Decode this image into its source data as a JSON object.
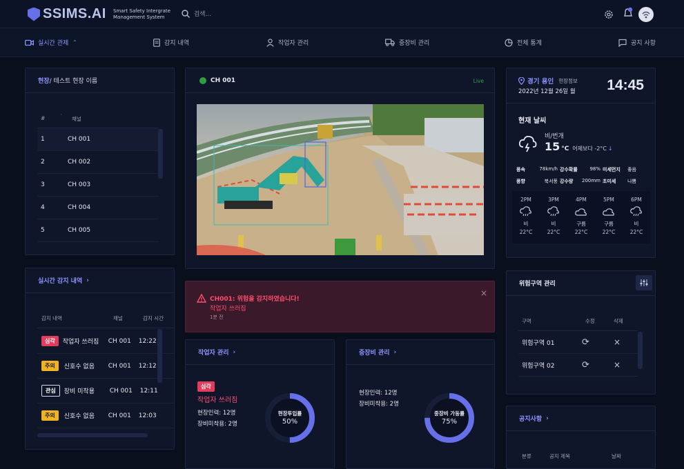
{
  "app": {
    "name": "SSIMS.AI",
    "subtitle_line1": "Smart Safety Intergrate",
    "subtitle_line2": "Management System",
    "search_placeholder": "검색..."
  },
  "nav": [
    {
      "label": "실시간 관제",
      "icon": "video-icon",
      "active": true
    },
    {
      "label": "감지 내역",
      "icon": "document-icon"
    },
    {
      "label": "작업자 관리",
      "icon": "user-icon"
    },
    {
      "label": "중장비 관리",
      "icon": "truck-icon"
    },
    {
      "label": "전체 통계",
      "icon": "pie-chart-icon"
    },
    {
      "label": "공지 사항",
      "icon": "message-icon"
    }
  ],
  "site": {
    "title_prefix": "현장",
    "title_rest": " / 테스트 현장 이름",
    "col_num": "#",
    "col_channel": "채널",
    "rows": [
      {
        "n": "1",
        "ch": "CH 001"
      },
      {
        "n": "2",
        "ch": "CH 002"
      },
      {
        "n": "3",
        "ch": "CH 003"
      },
      {
        "n": "4",
        "ch": "CH 004"
      },
      {
        "n": "5",
        "ch": "CH 005"
      }
    ]
  },
  "detect": {
    "title": "실시간 감지 내역",
    "col_type": "감지 내역",
    "col_channel": "채널",
    "col_time": "감지 시간",
    "rows": [
      {
        "badge": "심각",
        "style": "b-red",
        "text": "작업자 쓰러짐",
        "ch": "CH 001",
        "time": "12:22"
      },
      {
        "badge": "주의",
        "style": "b-yel",
        "text": "신호수 없음",
        "ch": "CH 001",
        "time": "12:12"
      },
      {
        "badge": "관심",
        "style": "b-out",
        "text": "장비 미착용",
        "ch": "CH 001",
        "time": "12:11"
      },
      {
        "badge": "주의",
        "style": "b-yel",
        "text": "신호수 없음",
        "ch": "CH 001",
        "time": "12:03"
      }
    ]
  },
  "camera": {
    "channel": "CH 001",
    "status": "Live"
  },
  "alert": {
    "title": "CH001: 위험을 감지하였습니다!",
    "message": "작업자 쓰러짐",
    "time": "1분 전"
  },
  "workers": {
    "title": "작업자 관리",
    "badge": "심각",
    "status": "작업자 쓰러짐",
    "line1": "현장인력: 12명",
    "line2": "장비미착용: 2명",
    "gauge_label": "현장투입률",
    "gauge_value": "50%",
    "gauge_fraction": 0.5
  },
  "equipment": {
    "title": "중장비 관리",
    "line1": "현장인력: 12명",
    "line2": "장비미착용: 2명",
    "gauge_label": "중장비 가동률",
    "gauge_value": "75%",
    "gauge_fraction": 0.75
  },
  "weather": {
    "location": "경기 용인",
    "location_sub": "현장정보",
    "date": "2022년 12월 26일 월",
    "time": "14:45",
    "section": "현재 날씨",
    "condition": "비/번개",
    "temp": "15",
    "unit": "°C",
    "compare": "어제보다 -2°C",
    "stats": [
      {
        "k": "풍속",
        "v": "78km/h",
        "k2": "강수확률",
        "v2": "98%",
        "k3": "미세먼지",
        "v3": "좋음"
      },
      {
        "k": "풍향",
        "v": "북서풍",
        "k2": "강수량",
        "v2": "200mm",
        "k3": "초미세",
        "v3": "나쁨"
      }
    ],
    "hourly": [
      {
        "h": "2PM",
        "c": "비",
        "t": "22°C",
        "icon": "rain-icon"
      },
      {
        "h": "3PM",
        "c": "비",
        "t": "22°C",
        "icon": "rain-icon"
      },
      {
        "h": "4PM",
        "c": "구름",
        "t": "22°C",
        "icon": "cloud-icon"
      },
      {
        "h": "5PM",
        "c": "구름",
        "t": "22°C",
        "icon": "cloud-icon"
      },
      {
        "h": "6PM",
        "c": "비",
        "t": "22°C",
        "icon": "rain-icon"
      }
    ]
  },
  "danger": {
    "title": "위험구역 관리",
    "col_zone": "구역",
    "col_edit": "수정",
    "col_del": "삭제",
    "rows": [
      {
        "zone": "위험구역 01"
      },
      {
        "zone": "위험구역 02"
      }
    ]
  },
  "notice": {
    "title": "공지사항",
    "col_cat": "분류",
    "col_title": "공지 제목",
    "col_date": "날짜"
  },
  "colors": {
    "accent": "#6670e8",
    "bg": "#0a0f1e",
    "danger": "#e23b5c",
    "warn": "#f2b320",
    "live": "#2ea043"
  }
}
